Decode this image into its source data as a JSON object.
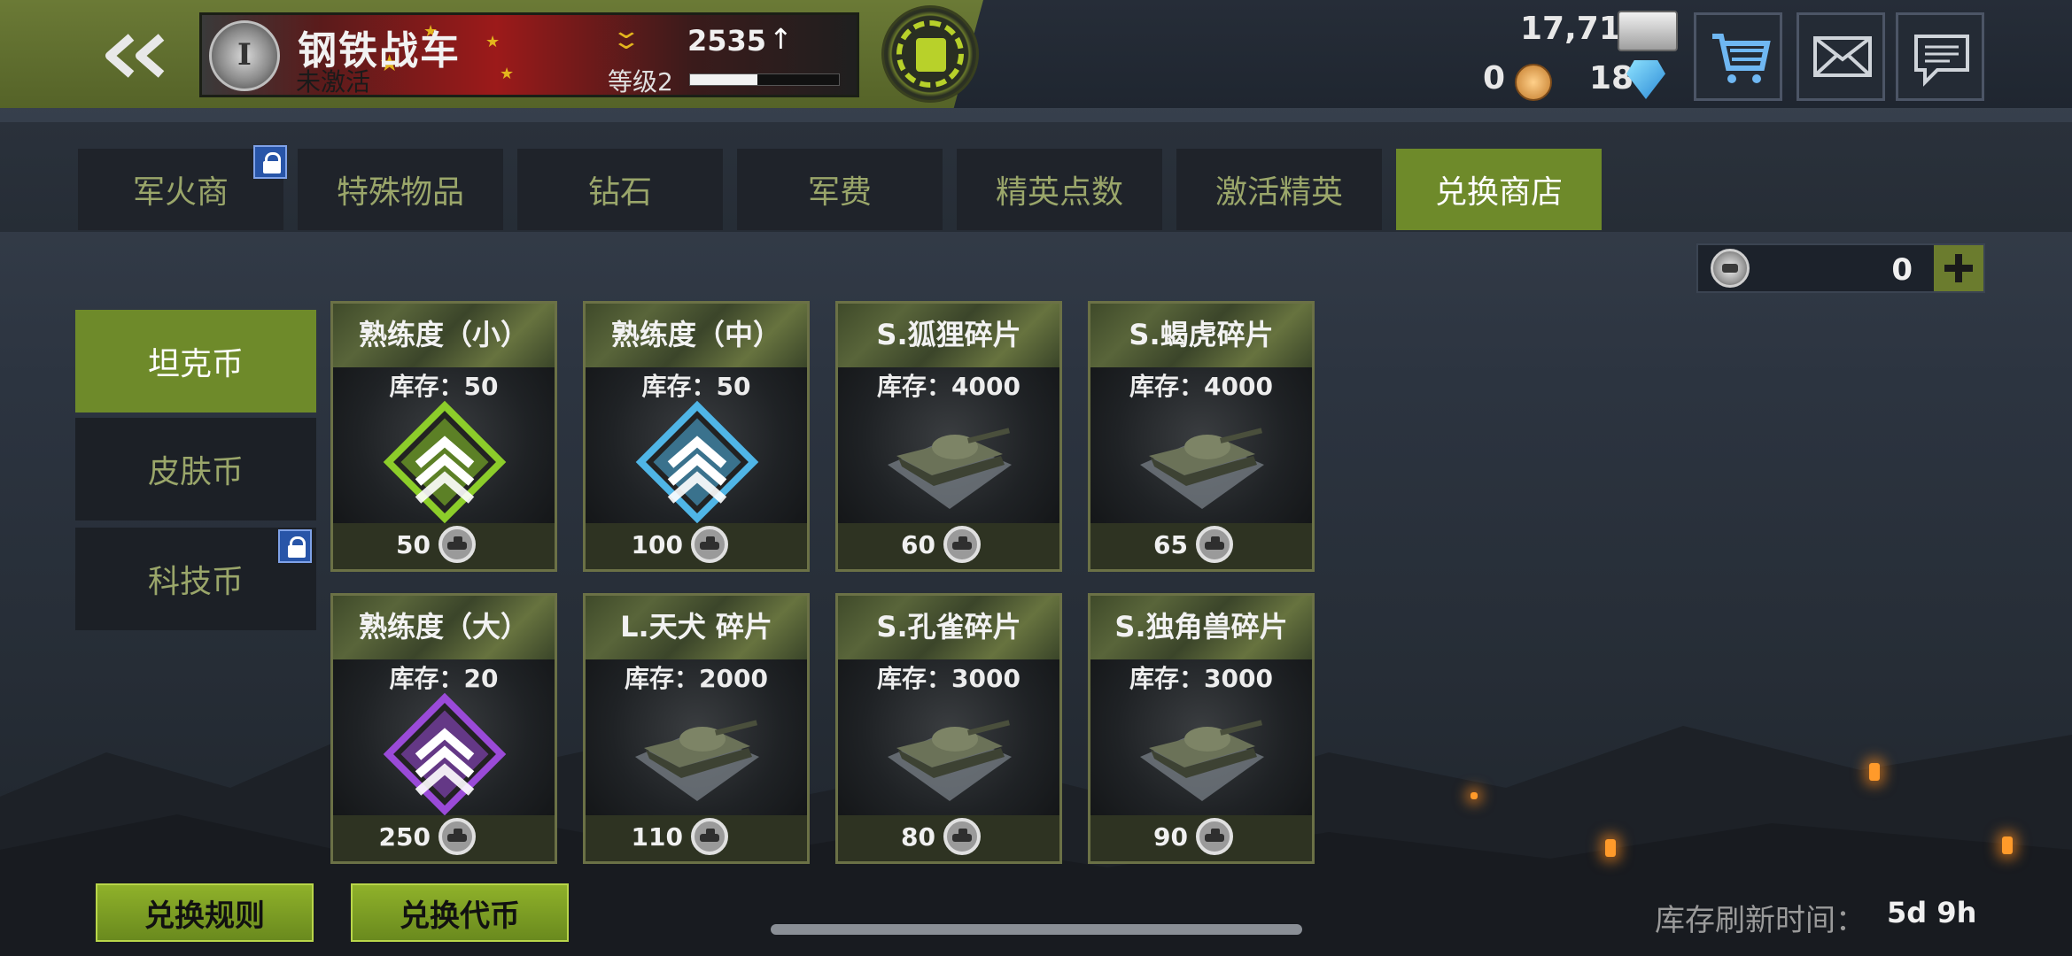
{
  "header": {
    "player_name": "钢铁战车",
    "player_status": "未激活",
    "rank_roman": "I",
    "power": "2535",
    "level": "等级2",
    "xp_progress": 0.45,
    "gold": "17,710",
    "medals": "0",
    "diamonds": "18"
  },
  "tabs": [
    {
      "label": "军火商",
      "locked": true,
      "active": false
    },
    {
      "label": "特殊物品",
      "locked": false,
      "active": false
    },
    {
      "label": "钻石",
      "locked": false,
      "active": false
    },
    {
      "label": "军费",
      "locked": false,
      "active": false
    },
    {
      "label": "精英点数",
      "locked": false,
      "active": false
    },
    {
      "label": "激活精英",
      "locked": false,
      "active": false
    },
    {
      "label": "兑换商店",
      "locked": false,
      "active": true
    }
  ],
  "balance": {
    "value": "0"
  },
  "side_tabs": [
    {
      "label": "坦克币",
      "active": true,
      "locked": false
    },
    {
      "label": "皮肤币",
      "active": false,
      "locked": false
    },
    {
      "label": "科技币",
      "active": false,
      "locked": true
    }
  ],
  "items": [
    {
      "title": "熟练度（小）",
      "stock": "库存：50",
      "price": "50",
      "icon": "green-chevron-badge-icon"
    },
    {
      "title": "熟练度（中）",
      "stock": "库存：50",
      "price": "100",
      "icon": "blue-chevron-badge-icon"
    },
    {
      "title": "S.狐狸碎片",
      "stock": "库存：4000",
      "price": "60",
      "icon": "tank-fragment-icon"
    },
    {
      "title": "S.蝎虎碎片",
      "stock": "库存：4000",
      "price": "65",
      "icon": "tank-fragment-icon"
    },
    {
      "title": "熟练度（大）",
      "stock": "库存：20",
      "price": "250",
      "icon": "purple-chevron-badge-icon"
    },
    {
      "title": "L.天犬 碎片",
      "stock": "库存：2000",
      "price": "110",
      "icon": "tank-fragment-icon"
    },
    {
      "title": "S.孔雀碎片",
      "stock": "库存：3000",
      "price": "80",
      "icon": "tank-fragment-icon"
    },
    {
      "title": "S.独角兽碎片",
      "stock": "库存：3000",
      "price": "90",
      "icon": "tank-fragment-icon"
    }
  ],
  "bottom": {
    "rules_label": "兑换规则",
    "exchange_label": "兑换代币",
    "refresh_label": "库存刷新时间：",
    "refresh_value": "5d 9h"
  },
  "colors": {
    "accent": "#6e8a2a",
    "button": "#8fb12a",
    "lock": "#2855a8",
    "green_badge": "#8ccd2a",
    "blue_badge": "#4fb5e6",
    "purple_badge": "#9a4ad8"
  }
}
